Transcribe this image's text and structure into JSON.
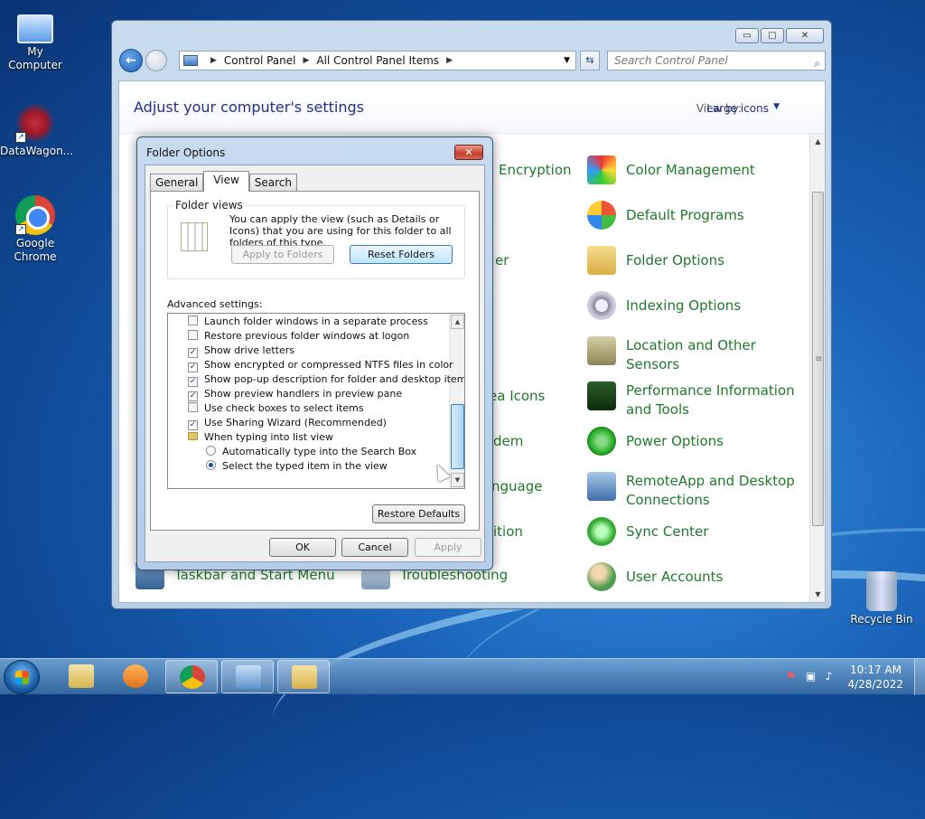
{
  "desktop": {
    "icons": [
      {
        "label": "My Computer"
      },
      {
        "label": "DataWagon..."
      },
      {
        "label": "Google Chrome"
      },
      {
        "label": "Recycle Bin"
      }
    ]
  },
  "control_panel": {
    "caption_buttons": {
      "minimize": "▭",
      "maximize": "□",
      "close": "✕"
    },
    "address": {
      "crumb1": "Control Panel",
      "crumb2": "All Control Panel Items"
    },
    "search_placeholder": "Search Control Panel",
    "heading": "Adjust your computer's settings",
    "view_by_label": "View by:",
    "view_by_value": "Large icons",
    "items": [
      {
        "label": "Encryption"
      },
      {
        "label": "er"
      },
      {
        "label": "ea Icons"
      },
      {
        "label": "dem"
      },
      {
        "label": "nguage"
      },
      {
        "label": "ition"
      },
      {
        "label": "Taskbar and Start Menu"
      },
      {
        "label": "Troubleshooting"
      },
      {
        "label": "Color Management"
      },
      {
        "label": "Default Programs"
      },
      {
        "label": "Folder Options"
      },
      {
        "label": "Indexing Options"
      },
      {
        "label": "Location and Other Sensors"
      },
      {
        "label": "Performance Information and Tools"
      },
      {
        "label": "Power Options"
      },
      {
        "label": "RemoteApp and Desktop Connections"
      },
      {
        "label": "Sync Center"
      },
      {
        "label": "User Accounts"
      }
    ]
  },
  "dialog": {
    "title": "Folder Options",
    "close": "✕",
    "tabs": [
      {
        "label": "General"
      },
      {
        "label": "View"
      },
      {
        "label": "Search"
      }
    ],
    "folder_views": {
      "label": "Folder views",
      "text": "You can apply the view (such as Details or Icons) that you are using for this folder to all folders of this type.",
      "apply_button": "Apply to Folders",
      "reset_button": "Reset Folders"
    },
    "advanced_label": "Advanced settings:",
    "settings": [
      {
        "label": "Launch folder windows in a separate process",
        "kind": "checkbox",
        "checked": false
      },
      {
        "label": "Restore previous folder windows at logon",
        "kind": "checkbox",
        "checked": false
      },
      {
        "label": "Show drive letters",
        "kind": "checkbox",
        "checked": true
      },
      {
        "label": "Show encrypted or compressed NTFS files in color",
        "kind": "checkbox",
        "checked": true
      },
      {
        "label": "Show pop-up description for folder and desktop items",
        "kind": "checkbox",
        "checked": true
      },
      {
        "label": "Show preview handlers in preview pane",
        "kind": "checkbox",
        "checked": true
      },
      {
        "label": "Use check boxes to select items",
        "kind": "checkbox",
        "checked": false
      },
      {
        "label": "Use Sharing Wizard (Recommended)",
        "kind": "checkbox",
        "checked": true
      },
      {
        "label": "When typing into list view",
        "kind": "folder",
        "checked": false
      },
      {
        "label": "Automatically type into the Search Box",
        "kind": "radio",
        "checked": false
      },
      {
        "label": "Select the typed item in the view",
        "kind": "radio",
        "checked": true
      }
    ],
    "restore_defaults": "Restore Defaults",
    "ok": "OK",
    "cancel": "Cancel",
    "apply": "Apply"
  },
  "taskbar": {
    "clock_time": "10:17 AM",
    "clock_date": "4/28/2022"
  }
}
